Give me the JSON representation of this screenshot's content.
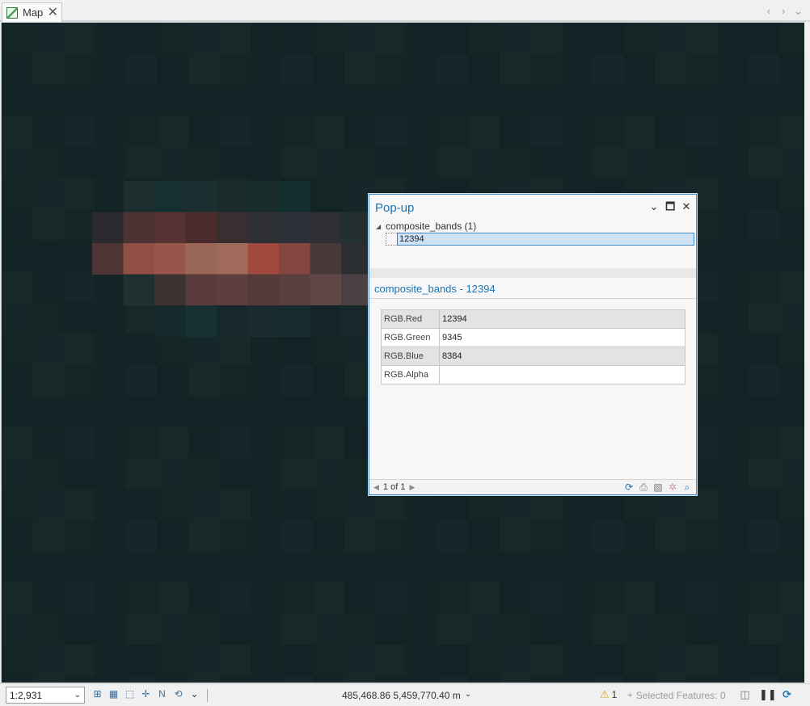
{
  "tab": {
    "label": "Map"
  },
  "popup": {
    "title": "Pop-up",
    "layer_label": "composite_bands (1)",
    "feature_label": "12394",
    "detail_title": "composite_bands - 12394",
    "fields": [
      {
        "name": "RGB.Red",
        "value": "12394"
      },
      {
        "name": "RGB.Green",
        "value": "9345"
      },
      {
        "name": "RGB.Blue",
        "value": "8384"
      },
      {
        "name": "RGB.Alpha",
        "value": ""
      }
    ],
    "pager": "1 of 1"
  },
  "status": {
    "scale": "1:2,931",
    "coordinates": "485,468.86 5,459,770.40 m",
    "warning_count": "1",
    "selected_features": "Selected Features: 0"
  },
  "colors": {
    "accent": "#1a74b4",
    "map_background": "#142526",
    "selection": "#cde2f4"
  },
  "map": {
    "highlight_pixels": [
      [
        "#1b2d2c",
        "#163030",
        "#1a2f2f",
        "#1a2d2c",
        "#1a2d2d",
        "#142f30"
      ],
      [
        "#2a2a2e",
        "#4a3332",
        "#573233",
        "#4b2b2c",
        "#3a2e31",
        "#2e3036",
        "#2d3038",
        "#2d2f33",
        "#242f2f"
      ],
      [
        "#4e3432",
        "#904e45",
        "#98554a",
        "#9a6657",
        "#a06a5a",
        "#a0493d",
        "#84463f",
        "#47393a",
        "#2a2e30"
      ],
      [
        "#1f3030",
        "#3a3332",
        "#5a3b3c",
        "#5c3e3e",
        "#563a3a",
        "#5a3f3f",
        "#604846",
        "#4b4142"
      ],
      [
        "#162a2c",
        "#173030",
        "#17282c",
        "#1a2c2e",
        "#182c2e",
        "#142527",
        "#18282a"
      ]
    ]
  }
}
